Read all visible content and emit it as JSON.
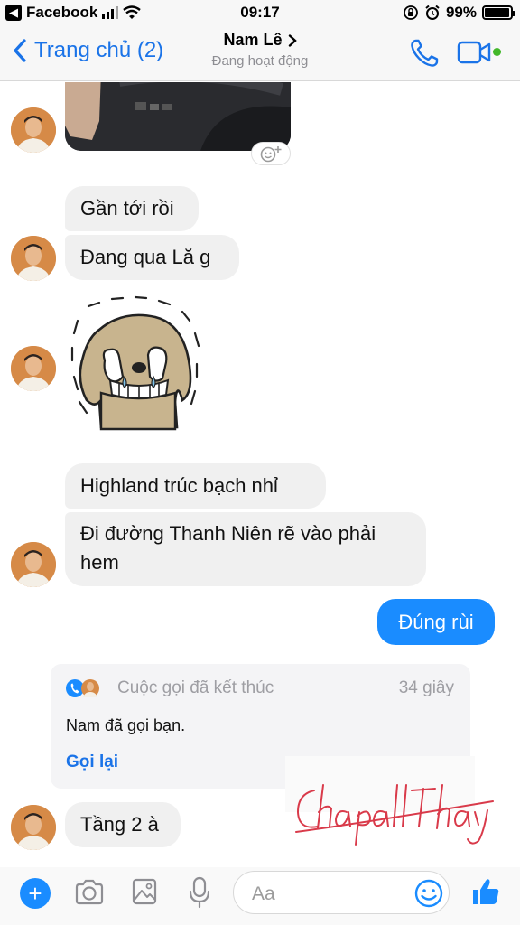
{
  "status_bar": {
    "back_app": "Facebook",
    "time": "09:17",
    "battery": "99%"
  },
  "header": {
    "back_label": "Trang chủ (2)",
    "contact_name": "Nam Lê",
    "contact_status": "Đang hoạt động"
  },
  "messages": {
    "m1": "Gần tới rồi",
    "m2": "Đang qua Lă g",
    "m3": "Highland trúc bạch nhỉ",
    "m4": "Đi đường Thanh Niên rẽ vào phải hem",
    "m5": "Đúng rùi",
    "m6": "Tầng 2 à"
  },
  "call_card": {
    "title": "Cuộc gọi đã kết thúc",
    "duration": "34 giây",
    "description": "Nam đã gọi bạn.",
    "action": "Gọi lại"
  },
  "composer": {
    "placeholder": "Aa"
  },
  "colors": {
    "accent": "#1a8cff",
    "link": "#1a73e8",
    "incoming_bubble": "#f0f0f0",
    "online": "#42b72a",
    "signature": "#d93a4a"
  },
  "icons": [
    "back-chevron-icon",
    "phone-icon",
    "video-camera-icon",
    "chevron-right-icon",
    "add-reaction-icon",
    "plus-icon",
    "camera-icon",
    "gallery-icon",
    "microphone-icon",
    "emoji-icon",
    "like-thumb-icon"
  ]
}
